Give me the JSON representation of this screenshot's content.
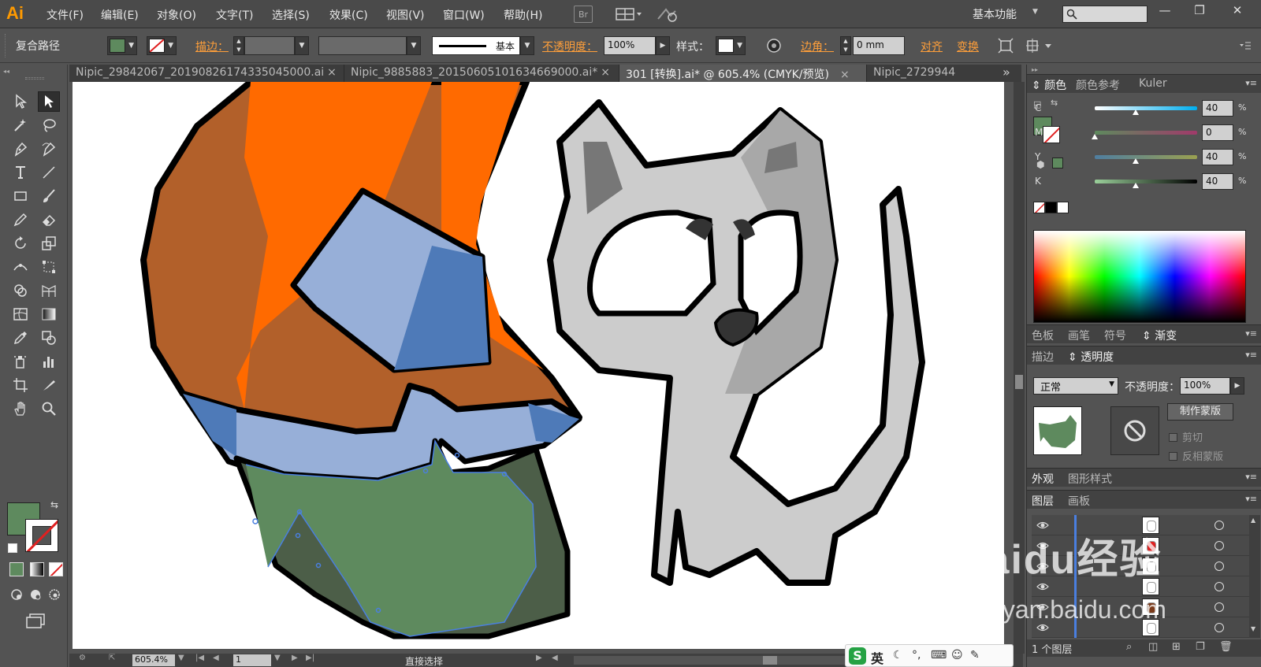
{
  "app": {
    "logo": "Ai"
  },
  "menu": [
    "文件(F)",
    "编辑(E)",
    "对象(O)",
    "文字(T)",
    "选择(S)",
    "效果(C)",
    "视图(V)",
    "窗口(W)",
    "帮助(H)"
  ],
  "menubar_icons": {
    "bridge": "Br",
    "arrange": "arrange-documents-icon",
    "gpu": "gpu-performance-icon"
  },
  "workspace": {
    "label": "基本功能"
  },
  "search": {
    "value": "",
    "placeholder": ""
  },
  "window_buttons": {
    "minimize": "—",
    "restore": "❐",
    "close": "✕"
  },
  "control": {
    "object_type": "复合路径",
    "fill_color": "#5e8a5e",
    "stroke_label": "描边：",
    "stroke_weight": "",
    "variable_width": "",
    "brush_def": "",
    "stroke_profile": "基本",
    "opacity_label": "不透明度：",
    "opacity_value": "100%",
    "style_label": "样式：",
    "corner_label": "边角：",
    "corner_value": "0 mm",
    "align_label": "对齐",
    "transform_label": "变换"
  },
  "tabs": [
    {
      "label": "Nipic_29842067_20190826174335045000.ai",
      "close": "×",
      "active": false
    },
    {
      "label": "Nipic_9885883_20150605101634669000.ai*",
      "close": "×",
      "active": false
    },
    {
      "label": "301 [转换].ai* @ 605.4% (CMYK/预览)",
      "close": "×",
      "active": true
    },
    {
      "label": "Nipic_2729944",
      "close": "",
      "active": false
    }
  ],
  "tabs_overflow": "»",
  "status": {
    "zoom": "605.4%",
    "page": "1",
    "tool": "直接选择"
  },
  "color_panel": {
    "tabs": [
      "颜色",
      "颜色参考",
      "Kuler"
    ],
    "active_tab": "颜色",
    "fill": "#5e8a5e",
    "channels": [
      {
        "label": "C",
        "value": "40",
        "pct": "%",
        "level": 0.4,
        "gradient": "linear-gradient(to right,#ffffff,#00aeef)"
      },
      {
        "label": "M",
        "value": "0",
        "pct": "%",
        "level": 0.0,
        "gradient": "linear-gradient(to right,#5e8a5e,#a03a6a)"
      },
      {
        "label": "Y",
        "value": "40",
        "pct": "%",
        "level": 0.4,
        "gradient": "linear-gradient(to right,#4f7ea0,#9aa050)"
      },
      {
        "label": "K",
        "value": "40",
        "pct": "%",
        "level": 0.4,
        "gradient": "linear-gradient(to right,#9ad09a,#000000)"
      }
    ]
  },
  "swatch_panel_tabs": [
    "色板",
    "画笔",
    "符号",
    "渐变"
  ],
  "stroke_panel_tabs": [
    "描边",
    "透明度"
  ],
  "transparency": {
    "blend_mode": "正常",
    "opacity_label": "不透明度：",
    "opacity_value": "100%",
    "make_mask": "制作蒙版",
    "clip": "剪切",
    "invert_mask": "反相蒙版"
  },
  "appearance_tabs": [
    "外观",
    "图形样式"
  ],
  "layers_tabs": [
    "图层",
    "画板"
  ],
  "layers": [
    {
      "thumb": "white-shape"
    },
    {
      "thumb": "red-shape"
    },
    {
      "thumb": "flame-shape"
    },
    {
      "thumb": "white-shape"
    },
    {
      "thumb": "brown-shape"
    },
    {
      "thumb": "cat-shape"
    }
  ],
  "layers_footer": {
    "count": "1 个图层"
  },
  "watermark": {
    "logo": "Baidu经验",
    "sub": "jingyan.baidu.com"
  },
  "ime": {
    "logo": "S",
    "lang": "英"
  }
}
